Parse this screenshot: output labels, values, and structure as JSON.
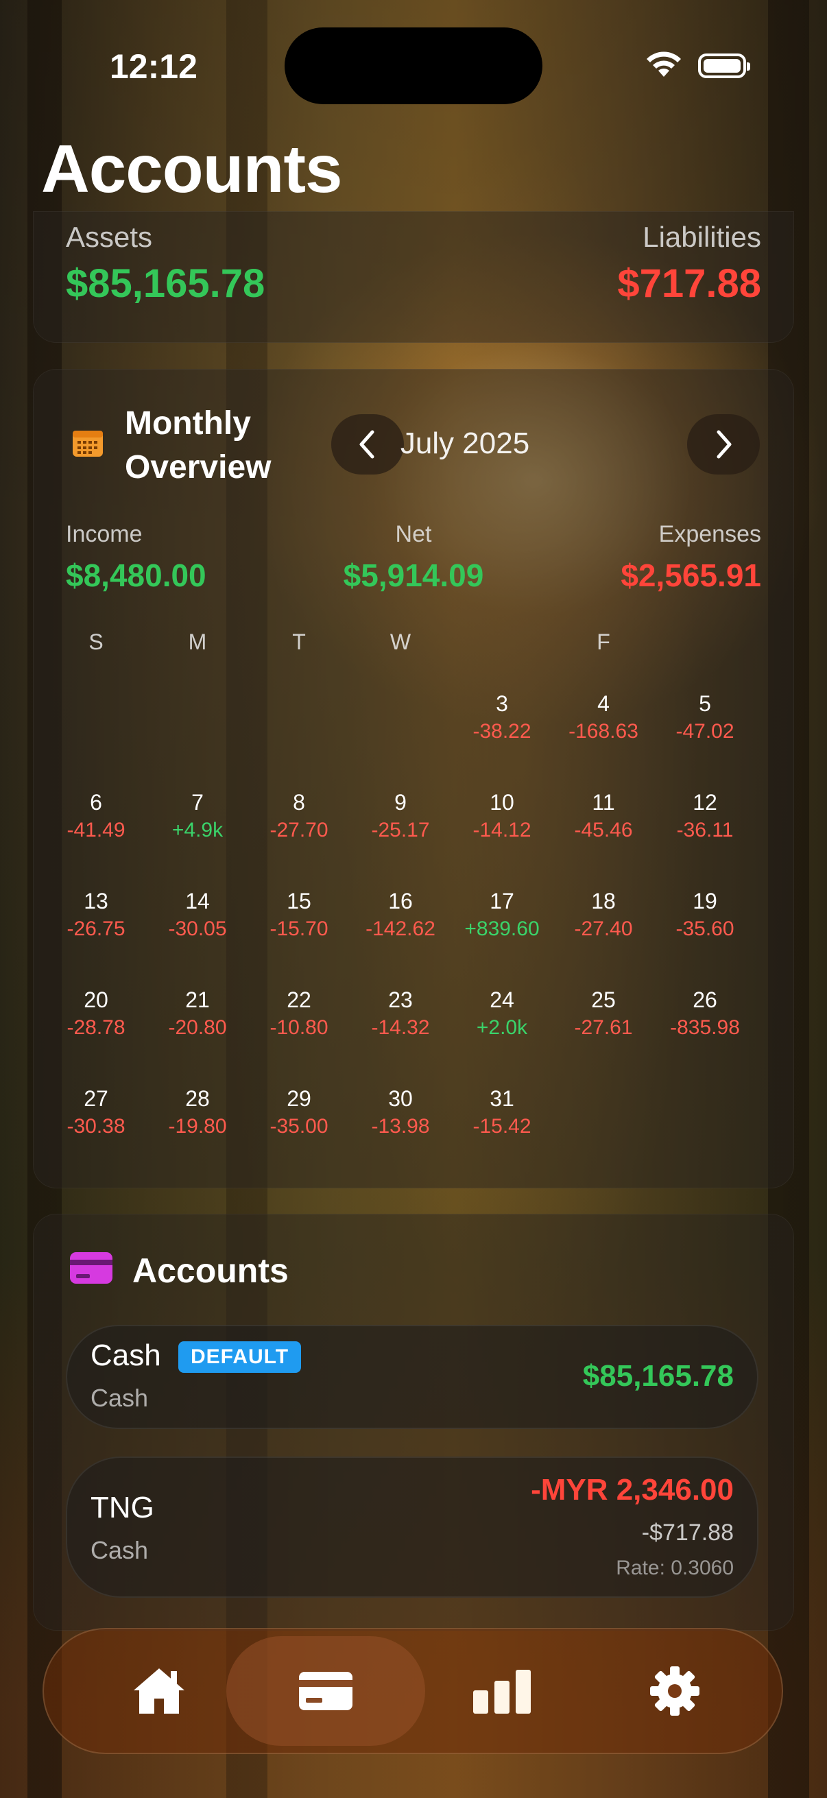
{
  "status": {
    "time": "12:12"
  },
  "page": {
    "title": "Accounts"
  },
  "summary": {
    "assets_label": "Assets",
    "assets_value": "$85,165.78",
    "liabilities_label": "Liabilities",
    "liabilities_value": "$717.88"
  },
  "monthly": {
    "title": "Monthly Overview",
    "month": "July 2025",
    "income_label": "Income",
    "income_value": "$8,480.00",
    "net_label": "Net",
    "net_value": "$5,914.09",
    "expenses_label": "Expenses",
    "expenses_value": "$2,565.91",
    "weekdays": [
      "S",
      "M",
      "T",
      "W",
      "",
      "F",
      ""
    ],
    "weeks": [
      [
        null,
        null,
        null,
        null,
        {
          "day": "3",
          "amount": "-38.22",
          "type": "neg"
        },
        {
          "day": "4",
          "amount": "-168.63",
          "type": "neg"
        },
        {
          "day": "5",
          "amount": "-47.02",
          "type": "neg"
        }
      ],
      [
        {
          "day": "6",
          "amount": "-41.49",
          "type": "neg"
        },
        {
          "day": "7",
          "amount": "+4.9k",
          "type": "pos"
        },
        {
          "day": "8",
          "amount": "-27.70",
          "type": "neg"
        },
        {
          "day": "9",
          "amount": "-25.17",
          "type": "neg"
        },
        {
          "day": "10",
          "amount": "-14.12",
          "type": "neg"
        },
        {
          "day": "11",
          "amount": "-45.46",
          "type": "neg"
        },
        {
          "day": "12",
          "amount": "-36.11",
          "type": "neg"
        }
      ],
      [
        {
          "day": "13",
          "amount": "-26.75",
          "type": "neg"
        },
        {
          "day": "14",
          "amount": "-30.05",
          "type": "neg"
        },
        {
          "day": "15",
          "amount": "-15.70",
          "type": "neg"
        },
        {
          "day": "16",
          "amount": "-142.62",
          "type": "neg"
        },
        {
          "day": "17",
          "amount": "+839.60",
          "type": "pos"
        },
        {
          "day": "18",
          "amount": "-27.40",
          "type": "neg"
        },
        {
          "day": "19",
          "amount": "-35.60",
          "type": "neg"
        }
      ],
      [
        {
          "day": "20",
          "amount": "-28.78",
          "type": "neg"
        },
        {
          "day": "21",
          "amount": "-20.80",
          "type": "neg"
        },
        {
          "day": "22",
          "amount": "-10.80",
          "type": "neg"
        },
        {
          "day": "23",
          "amount": "-14.32",
          "type": "neg"
        },
        {
          "day": "24",
          "amount": "+2.0k",
          "type": "pos"
        },
        {
          "day": "25",
          "amount": "-27.61",
          "type": "neg"
        },
        {
          "day": "26",
          "amount": "-835.98",
          "type": "neg"
        }
      ],
      [
        {
          "day": "27",
          "amount": "-30.38",
          "type": "neg"
        },
        {
          "day": "28",
          "amount": "-19.80",
          "type": "neg"
        },
        {
          "day": "29",
          "amount": "-35.00",
          "type": "neg"
        },
        {
          "day": "30",
          "amount": "-13.98",
          "type": "neg"
        },
        {
          "day": "31",
          "amount": "-15.42",
          "type": "neg"
        },
        null,
        null
      ]
    ]
  },
  "accounts": {
    "title": "Accounts",
    "items": [
      {
        "name": "Cash",
        "badge": "DEFAULT",
        "type": "Cash",
        "balance": "$85,165.78"
      },
      {
        "name": "TNG",
        "type": "Cash",
        "balance": "-MYR 2,346.00",
        "converted": "-$717.88",
        "rate": "Rate: 0.3060"
      }
    ]
  },
  "tabs": [
    {
      "icon": "home-icon",
      "active": false
    },
    {
      "icon": "credit-card-icon",
      "active": true
    },
    {
      "icon": "bar-chart-icon",
      "active": false
    },
    {
      "icon": "gear-icon",
      "active": false
    }
  ],
  "colors": {
    "positive": "#34c759",
    "negative": "#ff453a",
    "badge": "#1f9bf0",
    "accounts_icon": "#d63ae0",
    "calendar_icon": "#f39a2c"
  }
}
